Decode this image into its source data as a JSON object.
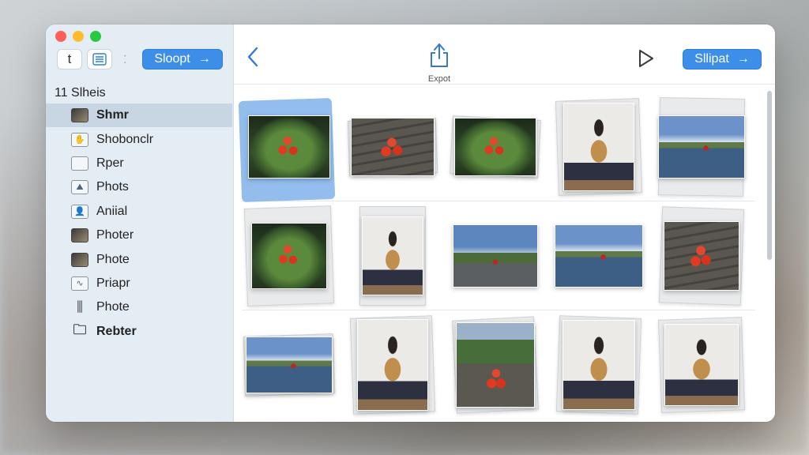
{
  "window": {
    "traffic_lights": [
      "close",
      "minimize",
      "zoom"
    ],
    "colors": {
      "accent": "#3d8ee8",
      "sidebar_bg": "#e4ecf4",
      "selected_row": "#c8d6e4"
    }
  },
  "sidebar": {
    "tool_text_label": "t",
    "export_button_label": "Sloopt",
    "export_button_arrow": "→",
    "heading": "11 Slheis",
    "items": [
      {
        "label": "Shmr",
        "icon": "photo-icon",
        "selected": true
      },
      {
        "label": "Shobonclr",
        "icon": "hand-icon"
      },
      {
        "label": "Rper",
        "icon": "square-icon"
      },
      {
        "label": "Phots",
        "icon": "image-icon"
      },
      {
        "label": "Aniial",
        "icon": "person-icon"
      },
      {
        "label": "Photer",
        "icon": "photo-icon"
      },
      {
        "label": "Phote",
        "icon": "photo-icon"
      },
      {
        "label": "Priapr",
        "icon": "waveform-icon"
      },
      {
        "label": "Phote",
        "icon": "sliders-icon"
      },
      {
        "label": "Rebter",
        "icon": "folder-icon",
        "bold": true
      }
    ]
  },
  "toolbar": {
    "back_glyph": "‹",
    "share_label": "Expot",
    "export_button_label": "Sllipat",
    "export_button_arrow": "→"
  },
  "grid": {
    "rows": [
      [
        "cherry-leaf",
        "cherry-wood",
        "cherry-leaf",
        "person",
        "lake"
      ],
      [
        "cherry-leaf",
        "person",
        "road",
        "lake",
        "cherry-wood"
      ],
      [
        "lake",
        "person",
        "valley",
        "person",
        "person"
      ]
    ],
    "selected": [
      0,
      0
    ]
  }
}
